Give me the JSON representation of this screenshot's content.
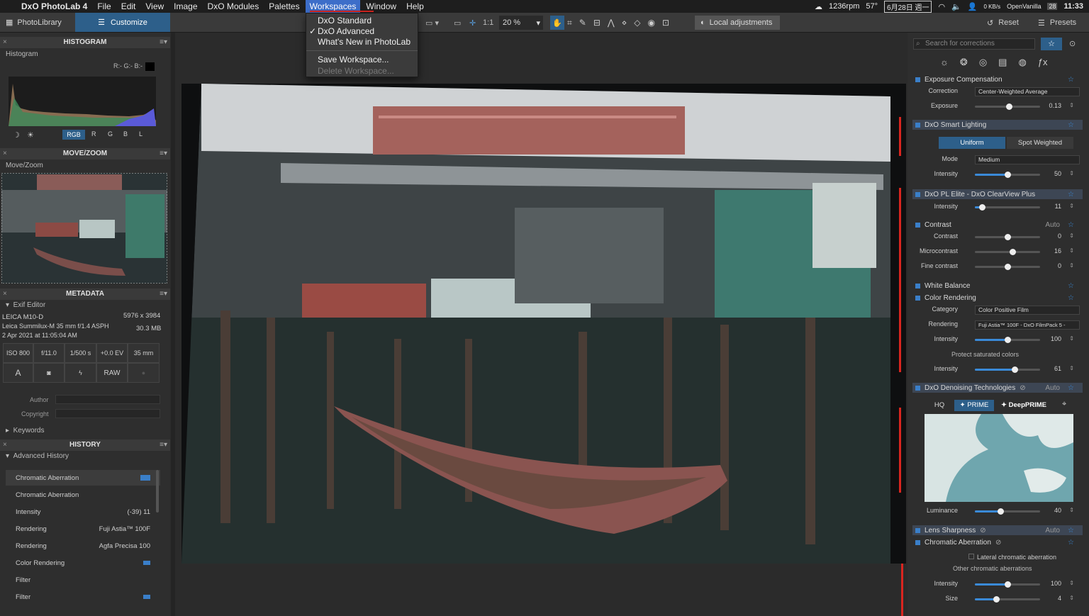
{
  "menubar": {
    "app": "DxO PhotoLab 4",
    "items": [
      "File",
      "Edit",
      "View",
      "Image",
      "DxO Modules",
      "Palettes",
      "Workspaces",
      "Window",
      "Help"
    ],
    "status": {
      "rpm": "1236rpm",
      "temp": "57°",
      "date": "6月28日 週一",
      "net_up": "0 KB/s",
      "net_down": "0 KB/s",
      "vpn": "OpenVanilla",
      "cal": "28",
      "clock": "11:33"
    }
  },
  "toolbar": {
    "tab_library": "PhotoLibrary",
    "tab_customize": "Customize",
    "ratio": "1:1",
    "zoom": "20 %",
    "local_adjust": "Local adjustments",
    "reset": "Reset",
    "presets": "Presets"
  },
  "workspace_menu": {
    "items": [
      "DxO Standard",
      "DxO Advanced",
      "What's New in PhotoLab",
      "Save Workspace...",
      "Delete Workspace..."
    ],
    "checked": "✓"
  },
  "left": {
    "histogram": {
      "title": "HISTOGRAM",
      "label": "Histogram",
      "readout": "R:- G:- B:-",
      "channels": [
        "RGB",
        "R",
        "G",
        "B",
        "L"
      ]
    },
    "movezoom": {
      "title": "MOVE/ZOOM",
      "label": "Move/Zoom"
    },
    "metadata": {
      "title": "METADATA",
      "label": "Exif Editor",
      "camera": "LEICA M10-D",
      "lens": "Leica Summilux-M 35 mm f/1.4 ASPH",
      "date": "2 Apr 2021 at 11:05:04 AM",
      "dims": "5976 x 3984",
      "size": "30.3 MB",
      "cells": [
        "ISO 800",
        "f/11.0",
        "1/500 s",
        "+0.0 EV",
        "35 mm"
      ],
      "row2": [
        "A",
        "RAW"
      ],
      "author": "Author",
      "copyright": "Copyright",
      "keywords": "Keywords"
    },
    "history": {
      "title": "HISTORY",
      "label": "Advanced History",
      "rows": [
        {
          "name": "Chromatic Aberration",
          "val": ""
        },
        {
          "name": "Chromatic Aberration",
          "val": ""
        },
        {
          "name": "Intensity",
          "val": "(-39)  11"
        },
        {
          "name": "Rendering",
          "val": "Fuji Astia™ 100F"
        },
        {
          "name": "Rendering",
          "val": "Agfa Precisa 100"
        },
        {
          "name": "Color Rendering",
          "val": ""
        },
        {
          "name": "Filter",
          "val": ""
        },
        {
          "name": "Filter",
          "val": ""
        }
      ]
    }
  },
  "right": {
    "search_placeholder": "Search for corrections",
    "exposure": {
      "title": "Exposure Compensation",
      "correction_label": "Correction",
      "correction": "Center-Weighted Average",
      "exposure_label": "Exposure",
      "exposure_val": "0.13"
    },
    "smart": {
      "title": "DxO Smart Lighting",
      "uniform": "Uniform",
      "spot": "Spot Weighted",
      "mode_label": "Mode",
      "mode": "Medium",
      "intensity_label": "Intensity",
      "intensity": "50"
    },
    "clearview": {
      "title": "DxO PL Elite - DxO ClearView Plus",
      "intensity_label": "Intensity",
      "intensity": "11"
    },
    "contrast": {
      "title": "Contrast",
      "auto": "Auto",
      "rows": [
        {
          "l": "Contrast",
          "v": "0",
          "p": 0.5
        },
        {
          "l": "Microcontrast",
          "v": "16",
          "p": 0.58
        },
        {
          "l": "Fine contrast",
          "v": "0",
          "p": 0.5
        }
      ]
    },
    "wb": {
      "title": "White Balance"
    },
    "color": {
      "title": "Color Rendering",
      "cat_label": "Category",
      "cat": "Color Positive Film",
      "rend_label": "Rendering",
      "rend": "Fuji Astia™ 100F - DxO FilmPack 5 -",
      "int_label": "Intensity",
      "int": "100",
      "protect": "Protect saturated colors",
      "pint_label": "Intensity",
      "pint": "61"
    },
    "denoise": {
      "title": "DxO Denoising Technologies",
      "auto": "Auto",
      "hq": "HQ",
      "prime": "PRIME",
      "deep": "DeepPRIME",
      "lum_label": "Luminance",
      "lum": "40"
    },
    "sharp": {
      "title": "Lens Sharpness",
      "auto": "Auto"
    },
    "ca": {
      "title": "Chromatic Aberration",
      "lateral": "Lateral chromatic aberration",
      "other": "Other chromatic aberrations",
      "int_label": "Intensity",
      "int": "100",
      "size_label": "Size",
      "size": "4"
    }
  }
}
